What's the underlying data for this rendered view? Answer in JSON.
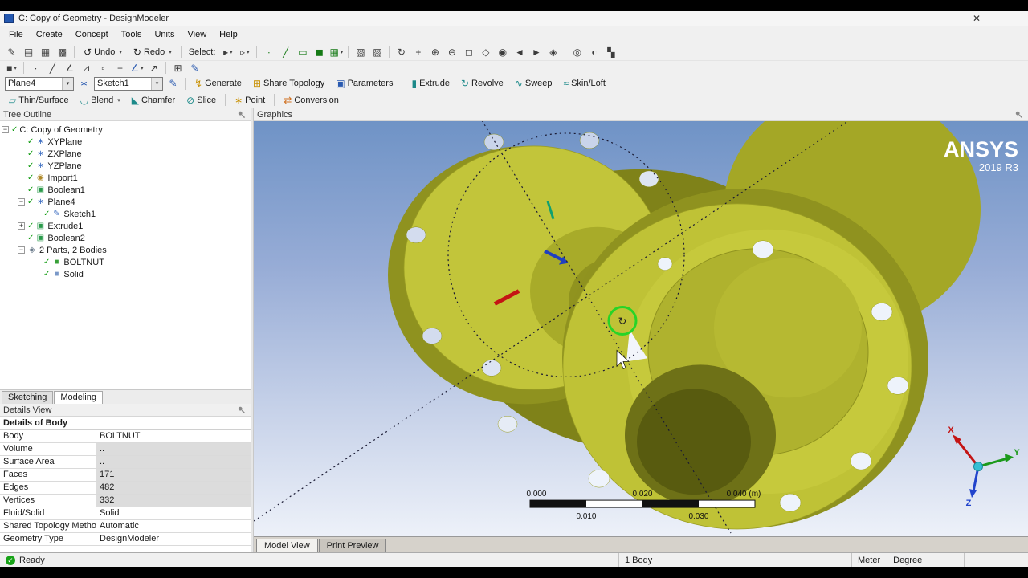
{
  "window": {
    "title": "C: Copy of Geometry - DesignModeler",
    "close_glyph": "✕"
  },
  "menu": {
    "items": [
      "File",
      "Create",
      "Concept",
      "Tools",
      "Units",
      "View",
      "Help"
    ]
  },
  "toolbars": {
    "row1": [
      {
        "type": "icon",
        "name": "new-sketch-button",
        "glyph": "✎"
      },
      {
        "type": "icon",
        "name": "open-button",
        "glyph": "▤"
      },
      {
        "type": "icon",
        "name": "save-button",
        "glyph": "▦"
      },
      {
        "type": "icon",
        "name": "image-capture-button",
        "glyph": "▩"
      },
      {
        "type": "sep"
      },
      {
        "type": "button",
        "name": "undo-button",
        "glyph": "↺",
        "label": "Undo",
        "drop": true
      },
      {
        "type": "button",
        "name": "redo-button",
        "glyph": "↻",
        "label": "Redo",
        "drop": true
      },
      {
        "type": "sep"
      },
      {
        "type": "label",
        "name": "select-label",
        "text": "Select:"
      },
      {
        "type": "icon",
        "name": "select-mode-button",
        "glyph": "▸",
        "drop": true
      },
      {
        "type": "icon",
        "name": "select-loops-button",
        "glyph": "▹",
        "drop": true
      },
      {
        "type": "sep"
      },
      {
        "type": "icon",
        "name": "filter-vertices-button",
        "glyph": "∙",
        "color": "green"
      },
      {
        "type": "icon",
        "name": "filter-edges-button",
        "glyph": "╱",
        "color": "green"
      },
      {
        "type": "icon",
        "name": "filter-faces-button",
        "glyph": "▭",
        "color": "green"
      },
      {
        "type": "icon",
        "name": "filter-bodies-button",
        "glyph": "◼",
        "color": "green"
      },
      {
        "type": "icon",
        "name": "adjacent-filter-button",
        "glyph": "▦",
        "color": "green",
        "drop": true
      },
      {
        "type": "sep"
      },
      {
        "type": "icon",
        "name": "box-select-button",
        "glyph": "▧"
      },
      {
        "type": "icon",
        "name": "lasso-select-button",
        "glyph": "▨"
      },
      {
        "type": "sep"
      },
      {
        "type": "icon",
        "name": "rotate-button",
        "glyph": "↻"
      },
      {
        "type": "icon",
        "name": "pan-button",
        "glyph": "+"
      },
      {
        "type": "icon",
        "name": "zoom-button",
        "glyph": "⊕"
      },
      {
        "type": "icon",
        "name": "zoom-out-button",
        "glyph": "⊖"
      },
      {
        "type": "icon",
        "name": "box-zoom-button",
        "glyph": "◻"
      },
      {
        "type": "icon",
        "name": "zoom-to-fit-button",
        "glyph": "◇"
      },
      {
        "type": "icon",
        "name": "magnifier-button",
        "glyph": "◉"
      },
      {
        "type": "icon",
        "name": "previous-view-button",
        "glyph": "◄"
      },
      {
        "type": "icon",
        "name": "next-view-button",
        "glyph": "►"
      },
      {
        "type": "icon",
        "name": "isometric-view-button",
        "glyph": "◈"
      },
      {
        "type": "sep"
      },
      {
        "type": "icon",
        "name": "look-at-button",
        "glyph": "◎"
      },
      {
        "type": "icon",
        "name": "display-mode-button",
        "glyph": "◐"
      },
      {
        "type": "icon",
        "name": "viewports-button",
        "glyph": "▚"
      }
    ],
    "row2": [
      {
        "type": "icon",
        "name": "display-style-button",
        "glyph": "■",
        "drop": true
      },
      {
        "type": "sep"
      },
      {
        "type": "icon",
        "name": "display-points-button",
        "glyph": "∙"
      },
      {
        "type": "icon",
        "name": "display-edges-button",
        "glyph": "╱"
      },
      {
        "type": "icon",
        "name": "display-hard-edges-button",
        "glyph": "∠"
      },
      {
        "type": "icon",
        "name": "display-tangent-edges-button",
        "glyph": "⊿"
      },
      {
        "type": "icon",
        "name": "display-vertices-button",
        "glyph": "▫"
      },
      {
        "type": "icon",
        "name": "display-crosshair-button",
        "glyph": "+"
      },
      {
        "type": "icon",
        "name": "edge-coloring-button",
        "glyph": "∠",
        "color": "blue",
        "drop": true
      },
      {
        "type": "icon",
        "name": "edge-direction-button",
        "glyph": "↗"
      },
      {
        "type": "sep"
      },
      {
        "type": "icon",
        "name": "sketch-grid-button",
        "glyph": "⊞"
      },
      {
        "type": "icon",
        "name": "snap-button",
        "glyph": "✎",
        "color": "blue"
      }
    ],
    "row3": [
      {
        "type": "combo",
        "name": "plane-selector",
        "text": "Plane4"
      },
      {
        "type": "icon",
        "name": "new-plane-button",
        "glyph": "∗",
        "color": "blue"
      },
      {
        "type": "combo",
        "name": "sketch-selector",
        "text": "Sketch1"
      },
      {
        "type": "icon",
        "name": "new-sketch-tool-button",
        "glyph": "✎",
        "color": "blue"
      },
      {
        "type": "sep"
      },
      {
        "type": "button",
        "name": "generate-button",
        "glyph": "↯",
        "color": "gold",
        "label": "Generate"
      },
      {
        "type": "button",
        "name": "share-topology-button",
        "glyph": "⊞",
        "color": "gold",
        "label": "Share Topology"
      },
      {
        "type": "button",
        "name": "parameters-button",
        "glyph": "▣",
        "color": "blue",
        "label": "Parameters"
      },
      {
        "type": "sep"
      },
      {
        "type": "button",
        "name": "extrude-button",
        "glyph": "▮",
        "color": "teal",
        "label": "Extrude"
      },
      {
        "type": "button",
        "name": "revolve-button",
        "glyph": "↻",
        "color": "teal",
        "label": "Revolve"
      },
      {
        "type": "button",
        "name": "sweep-button",
        "glyph": "∿",
        "color": "teal",
        "label": "Sweep"
      },
      {
        "type": "button",
        "name": "skin-loft-button",
        "glyph": "≈",
        "color": "teal",
        "label": "Skin/Loft"
      }
    ],
    "row4": [
      {
        "type": "button",
        "name": "thin-surface-button",
        "glyph": "▱",
        "color": "teal",
        "label": "Thin/Surface"
      },
      {
        "type": "button",
        "name": "blend-button",
        "glyph": "◡",
        "color": "teal",
        "label": "Blend",
        "drop": true
      },
      {
        "type": "button",
        "name": "chamfer-button",
        "glyph": "◣",
        "color": "teal",
        "label": "Chamfer"
      },
      {
        "type": "button",
        "name": "slice-button",
        "glyph": "⊘",
        "color": "teal",
        "label": "Slice"
      },
      {
        "type": "sep"
      },
      {
        "type": "button",
        "name": "point-button",
        "glyph": "∗",
        "color": "gold",
        "label": "Point"
      },
      {
        "type": "sep"
      },
      {
        "type": "button",
        "name": "conversion-button",
        "glyph": "⇄",
        "color": "orange",
        "label": "Conversion"
      }
    ]
  },
  "tree": {
    "header": "Tree Outline",
    "iconGlyphs": {
      "plane": "∗",
      "import": "◉",
      "boolean": "▣",
      "sketch": "✎",
      "extrude": "▣",
      "parts": "◈",
      "body-green": "■",
      "body-blue": "■"
    },
    "items": [
      {
        "label": "C: Copy of Geometry",
        "level": 0,
        "exp": "minus",
        "check": true,
        "icon": ""
      },
      {
        "label": "XYPlane",
        "level": 1,
        "check": true,
        "icon": "plane"
      },
      {
        "label": "ZXPlane",
        "level": 1,
        "check": true,
        "icon": "plane"
      },
      {
        "label": "YZPlane",
        "level": 1,
        "check": true,
        "icon": "plane"
      },
      {
        "label": "Import1",
        "level": 1,
        "check": true,
        "icon": "import"
      },
      {
        "label": "Boolean1",
        "level": 1,
        "check": true,
        "icon": "boolean"
      },
      {
        "label": "Plane4",
        "level": 1,
        "exp": "minus",
        "check": true,
        "icon": "plane"
      },
      {
        "label": "Sketch1",
        "level": 2,
        "check": true,
        "icon": "sketch"
      },
      {
        "label": "Extrude1",
        "level": 1,
        "exp": "plus",
        "check": true,
        "icon": "extrude"
      },
      {
        "label": "Boolean2",
        "level": 1,
        "check": true,
        "icon": "boolean"
      },
      {
        "label": "2 Parts, 2 Bodies",
        "level": 1,
        "exp": "minus",
        "check": false,
        "icon": "parts"
      },
      {
        "label": "BOLTNUT",
        "level": 2,
        "check": true,
        "icon": "body-green"
      },
      {
        "label": "Solid",
        "level": 2,
        "check": true,
        "icon": "body-blue"
      }
    ]
  },
  "tabs": {
    "sketching": "Sketching",
    "modeling": "Modeling"
  },
  "details": {
    "header": "Details View",
    "section_title": "Details of Body",
    "rows": [
      {
        "label": "Body",
        "value": "BOLTNUT",
        "shaded": false
      },
      {
        "label": "Volume",
        "value": "..",
        "shaded": true
      },
      {
        "label": "Surface Area",
        "value": "..",
        "shaded": true
      },
      {
        "label": "Faces",
        "value": "171",
        "shaded": true
      },
      {
        "label": "Edges",
        "value": "482",
        "shaded": true
      },
      {
        "label": "Vertices",
        "value": "332",
        "shaded": true
      },
      {
        "label": "Fluid/Solid",
        "value": "Solid",
        "shaded": false
      },
      {
        "label": "Shared Topology Method",
        "value": "Automatic",
        "shaded": false
      },
      {
        "label": "Geometry Type",
        "value": "DesignModeler",
        "shaded": false
      }
    ]
  },
  "graphics": {
    "header": "Graphics",
    "tabs": [
      "Model View",
      "Print Preview"
    ],
    "logo": {
      "line1": "ANSYS",
      "line2": "2019 R3"
    },
    "ruler": {
      "top": [
        "0.000",
        "0.020",
        "0.040 (m)"
      ],
      "bottom": [
        "0.010",
        "0.030"
      ]
    },
    "triad": {
      "x": "X",
      "y": "Y",
      "z": "Z"
    },
    "rotate_glyph": "↻"
  },
  "statusbar": {
    "ready": "Ready",
    "ready_glyph": "✓",
    "bodies": "1 Body",
    "unit_length": "Meter",
    "unit_angle": "Degree"
  },
  "colors": {
    "model_yellow": "#c2c53a",
    "model_dark": "#8f921f",
    "sky_top": "#6f93c6",
    "sky_bottom": "#edf1f9",
    "ready_green": "#17a317",
    "cursor_green": "#27d427",
    "axis_x_red": "#c41414",
    "axis_y_green": "#22aa22",
    "axis_z_blue": "#2244cc"
  }
}
